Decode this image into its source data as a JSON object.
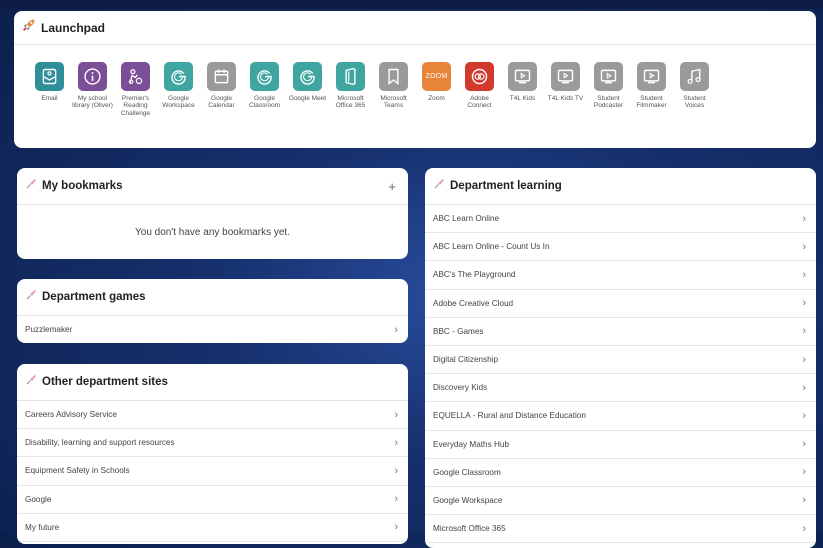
{
  "launchpad": {
    "title": "Launchpad",
    "apps": [
      {
        "label": "Email",
        "icon": "email-icon",
        "color": "#2e8f9a"
      },
      {
        "label": "My school library (Oliver)",
        "icon": "info-icon",
        "color": "#7a4f97"
      },
      {
        "label": "Premier's Reading Challenge",
        "icon": "reading-challenge-icon",
        "color": "#7a4f97"
      },
      {
        "label": "Google Workspace",
        "icon": "google-g-icon",
        "color": "#3ea5a0"
      },
      {
        "label": "Google Calendar",
        "icon": "calendar-icon",
        "color": "#9a9a9a"
      },
      {
        "label": "Google Classroom",
        "icon": "google-g-icon",
        "color": "#3ea5a0"
      },
      {
        "label": "Google Meet",
        "icon": "google-g-icon",
        "color": "#3ea5a0"
      },
      {
        "label": "Microsoft Office 365",
        "icon": "office-icon",
        "color": "#3ea5a0"
      },
      {
        "label": "Microsoft Teams",
        "icon": "bookmark-icon",
        "color": "#9a9a9a"
      },
      {
        "label": "Zoom",
        "icon": "zoom-icon",
        "color": "#e8833a",
        "tile_text": "ZOOM"
      },
      {
        "label": "Adobe Connect",
        "icon": "adobe-connect-icon",
        "color": "#d23a2e"
      },
      {
        "label": "T4L Kids",
        "icon": "video-icon",
        "color": "#9a9a9a"
      },
      {
        "label": "T4L Kids TV",
        "icon": "video-icon",
        "color": "#9a9a9a"
      },
      {
        "label": "Student Podcaster",
        "icon": "video-icon",
        "color": "#9a9a9a"
      },
      {
        "label": "Student Filmmaker",
        "icon": "video-icon",
        "color": "#9a9a9a"
      },
      {
        "label": "Student Voices",
        "icon": "music-note-icon",
        "color": "#9a9a9a"
      }
    ]
  },
  "bookmarks": {
    "title": "My bookmarks",
    "add_label": "+",
    "empty_text": "You don't have any bookmarks yet."
  },
  "games": {
    "title": "Department games",
    "items": [
      "Puzzlemaker"
    ]
  },
  "other_sites": {
    "title": "Other department sites",
    "items": [
      "Careers Advisory Service",
      "Disability, learning and support resources",
      "Equipment Safety in Schools",
      "Google",
      "My future"
    ]
  },
  "learning": {
    "title": "Department learning",
    "items": [
      "ABC Learn Online",
      "ABC Learn Online - Count Us In",
      "ABC's The Playground",
      "Adobe Creative Cloud",
      "BBC - Games",
      "Digital Citizenship",
      "Discovery Kids",
      "EQUELLA - Rural and Distance Education",
      "Everyday Maths Hub",
      "Google Classroom",
      "Google Workspace",
      "Microsoft Office 365"
    ]
  },
  "chevron": "›",
  "colors": {
    "rocket": "#e08a3c",
    "pin": "#e7a4a4",
    "background": "#16306d"
  }
}
